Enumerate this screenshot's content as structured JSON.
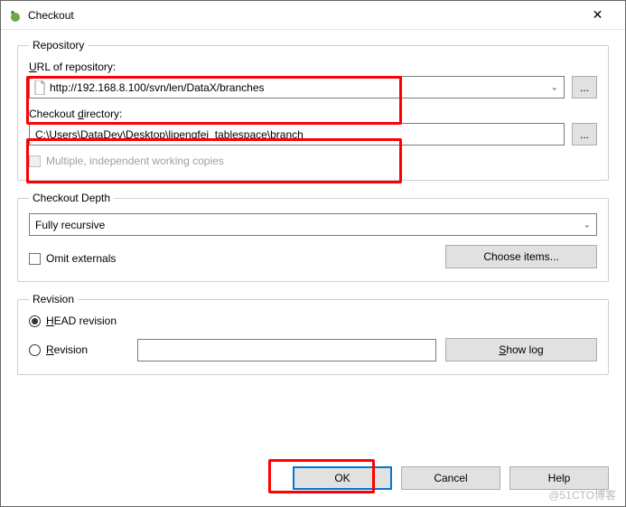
{
  "window": {
    "title": "Checkout",
    "close": "✕"
  },
  "repository": {
    "legend": "Repository",
    "url_label_pre": "U",
    "url_label_text": "RL of repository:",
    "url_value": "http://192.168.8.100/svn/len/DataX/branches",
    "dir_label_text": "Checkout ",
    "dir_label_u": "d",
    "dir_label_post": "irectory:",
    "dir_value": "C:\\Users\\DataDev\\Desktop\\lipengfei_tablespace\\branch",
    "multiple_label": "Multiple, independent working copies",
    "browse": "..."
  },
  "depth": {
    "legend": "Checkout Depth",
    "value": "Fully recursive",
    "omit_label": "Omit externals",
    "choose_label": "Choose items..."
  },
  "revision": {
    "legend": "Revision",
    "head_pre": "H",
    "head_text": "EAD revision",
    "rev_pre": "R",
    "rev_text": "evision",
    "rev_value": "",
    "showlog_pre": "S",
    "showlog_text": "how log"
  },
  "footer": {
    "ok": "OK",
    "cancel": "Cancel",
    "help": "Help"
  },
  "watermark": "@51CTO博客"
}
